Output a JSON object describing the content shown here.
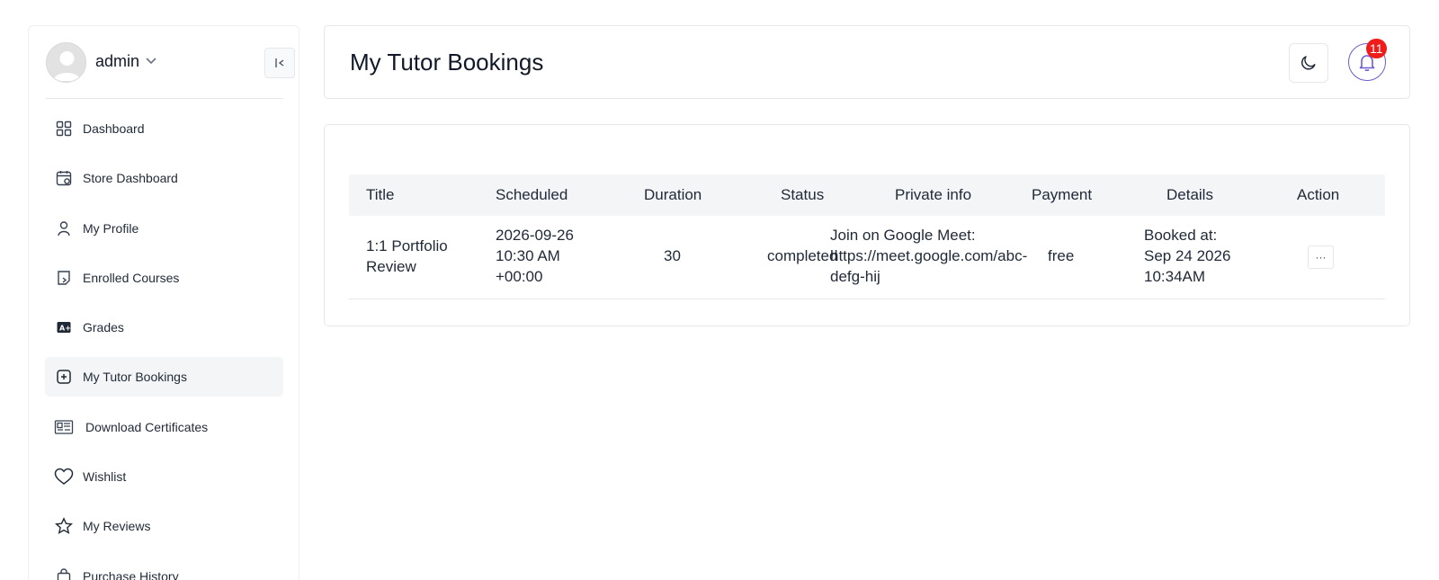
{
  "sidebar": {
    "user": {
      "name": "admin"
    },
    "items": [
      {
        "label": "Dashboard",
        "icon": "dashboard-grid-icon"
      },
      {
        "label": "Store Dashboard",
        "icon": "calendar-settings-icon"
      },
      {
        "label": "My Profile",
        "icon": "user-icon"
      },
      {
        "label": "Enrolled Courses",
        "icon": "course-icon"
      },
      {
        "label": "Grades",
        "icon": "grade-icon"
      },
      {
        "label": "My Tutor Bookings",
        "icon": "booking-icon",
        "active": true
      },
      {
        "label": "Download Certificates",
        "icon": "certificate-icon"
      },
      {
        "label": "Wishlist",
        "icon": "heart-icon"
      },
      {
        "label": "My Reviews",
        "icon": "star-icon"
      },
      {
        "label": "Purchase History",
        "icon": "shopping-bag-icon"
      }
    ]
  },
  "header": {
    "title": "My Tutor Bookings",
    "notification_count": "11"
  },
  "table": {
    "columns": [
      "Title",
      "Scheduled",
      "Duration",
      "Status",
      "Private info",
      "Payment",
      "Details",
      "Action"
    ],
    "rows": [
      {
        "title": [
          "1:1 Portfolio",
          "Review"
        ],
        "scheduled": [
          "2026-09-26",
          "10:30 AM",
          "+00:00"
        ],
        "duration": "30",
        "status": "completed",
        "private_info": [
          "Join on Google Meet:",
          "https://meet.google.com/abc-",
          "defg-hij"
        ],
        "payment": "free",
        "details": [
          "Booked at:",
          "Sep 24 2026",
          "10:34AM"
        ],
        "action": "···"
      }
    ]
  },
  "colors": {
    "accent": "#6d5bd0",
    "badge": "#ef1c1c",
    "active_bg": "#f4f5f6",
    "table_head_bg": "#f4f5f7"
  }
}
